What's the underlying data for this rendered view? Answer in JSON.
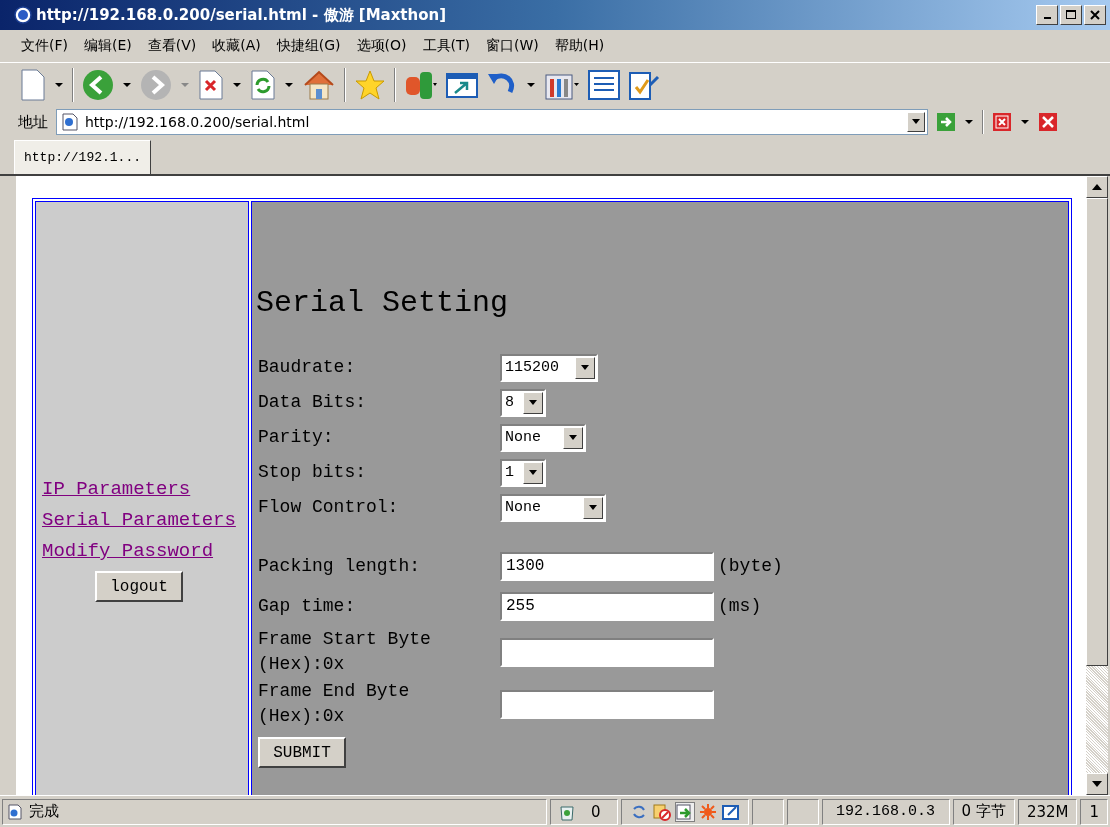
{
  "window": {
    "title": "http://192.168.0.200/serial.html - 傲游 [Maxthon]"
  },
  "menu": [
    "文件(F)",
    "编辑(E)",
    "查看(V)",
    "收藏(A)",
    "快捷组(G)",
    "选项(O)",
    "工具(T)",
    "窗口(W)",
    "帮助(H)"
  ],
  "address_bar": {
    "label": "地址",
    "url": "http://192.168.0.200/serial.html"
  },
  "tabs": [
    {
      "label": "http://192.1...",
      "selected": true
    }
  ],
  "sidebar": {
    "links": [
      "IP Parameters",
      "Serial Parameters",
      "Modify Password"
    ],
    "logout_button": "logout"
  },
  "form": {
    "title": "Serial Setting",
    "selects": [
      {
        "label": "Baudrate:",
        "value": "115200"
      },
      {
        "label": "Data Bits:",
        "value": "8"
      },
      {
        "label": "Parity:",
        "value": "None"
      },
      {
        "label": "Stop bits:",
        "value": "1"
      },
      {
        "label": "Flow Control:",
        "value": "None"
      }
    ],
    "inputs": [
      {
        "label": "Packing length:",
        "value": "1300",
        "unit": "(byte)"
      },
      {
        "label": "Gap time:",
        "value": "255",
        "unit": "(ms)"
      },
      {
        "label": "Frame Start Byte (Hex):0x"
      },
      {
        "label": "Frame End Byte (Hex):0x"
      }
    ],
    "submit_button": "SUBMIT"
  },
  "status_bar": {
    "text": "完成",
    "count": "0",
    "ip": "192.168.0.3",
    "bytes": "0 字节",
    "memory": "232M",
    "page": "1"
  }
}
